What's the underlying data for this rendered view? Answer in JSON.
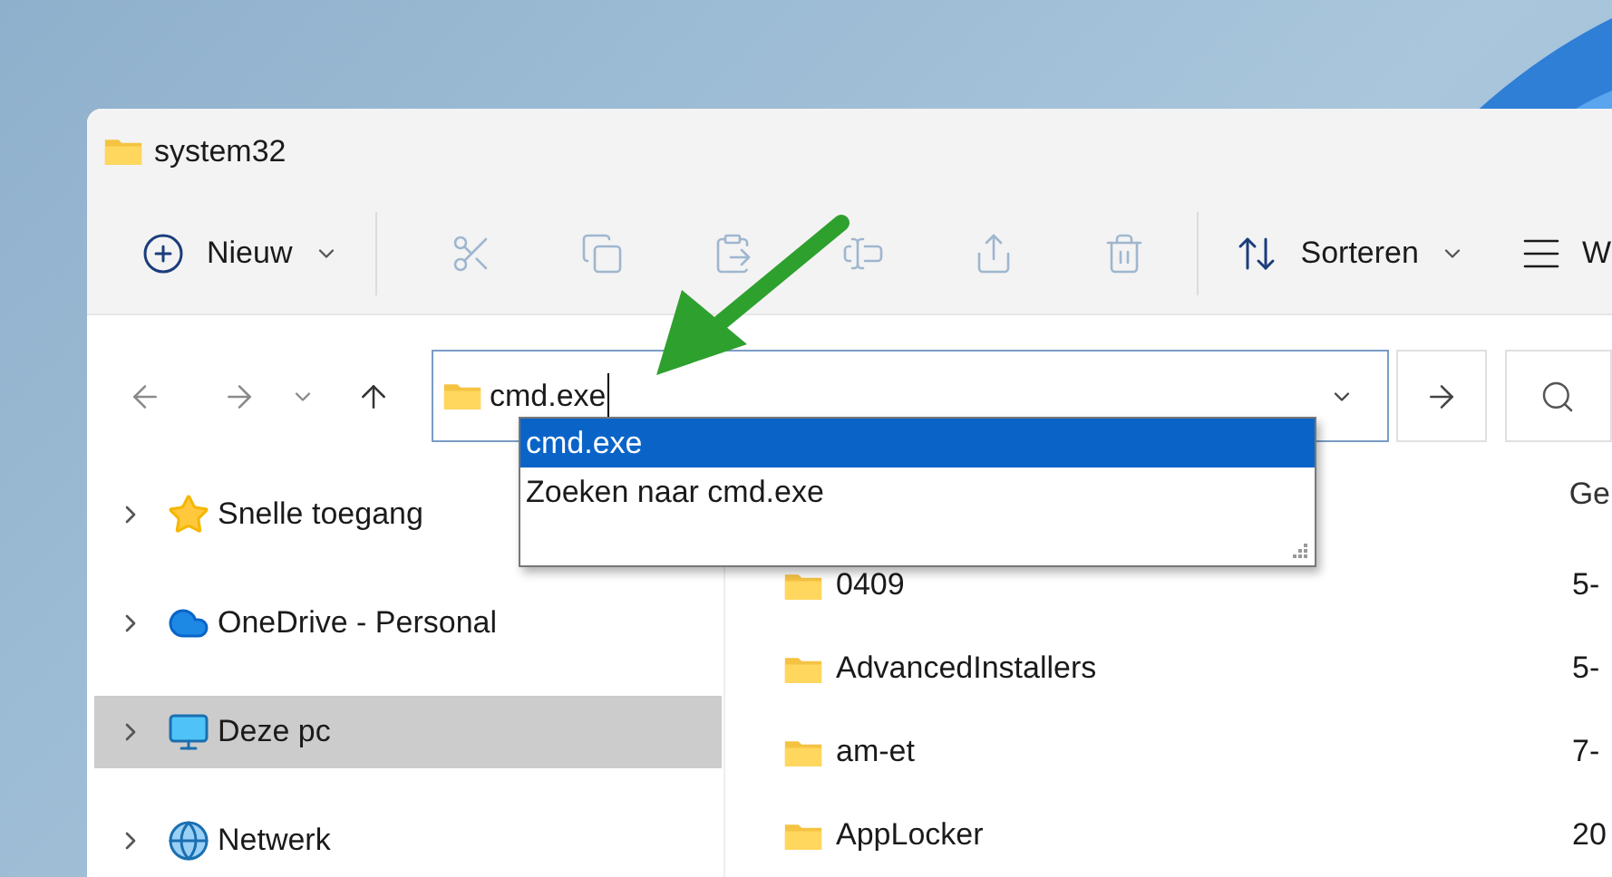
{
  "window": {
    "title": "system32"
  },
  "toolbar": {
    "new_button": "Nieuw",
    "actions": [
      {
        "kind": "cut",
        "disabled": true
      },
      {
        "kind": "copy",
        "disabled": true
      },
      {
        "kind": "paste",
        "disabled": true
      },
      {
        "kind": "rename",
        "disabled": true
      },
      {
        "kind": "share",
        "disabled": true
      },
      {
        "kind": "delete",
        "disabled": true
      }
    ],
    "sort_button": "Sorteren",
    "view_button": "W"
  },
  "address_bar": {
    "value": "cmd.exe"
  },
  "autocomplete": [
    {
      "label": "cmd.exe",
      "selected": true
    },
    {
      "label": "Zoeken naar cmd.exe",
      "selected": false
    }
  ],
  "sidebar": {
    "items": [
      {
        "label": "Snelle toegang",
        "kind": "star",
        "selected": false
      },
      {
        "label": "OneDrive - Personal",
        "kind": "cloud",
        "selected": false
      },
      {
        "label": "Deze pc",
        "kind": "pc",
        "selected": true
      },
      {
        "label": "Netwerk",
        "kind": "network",
        "selected": false
      }
    ]
  },
  "file_list": {
    "column_2_header": "Ge",
    "rows": [
      {
        "name": "0409",
        "column_2": "5-"
      },
      {
        "name": "AdvancedInstallers",
        "column_2": "5-"
      },
      {
        "name": "am-et",
        "column_2": "7-"
      },
      {
        "name": "AppLocker",
        "column_2": "20"
      }
    ]
  }
}
